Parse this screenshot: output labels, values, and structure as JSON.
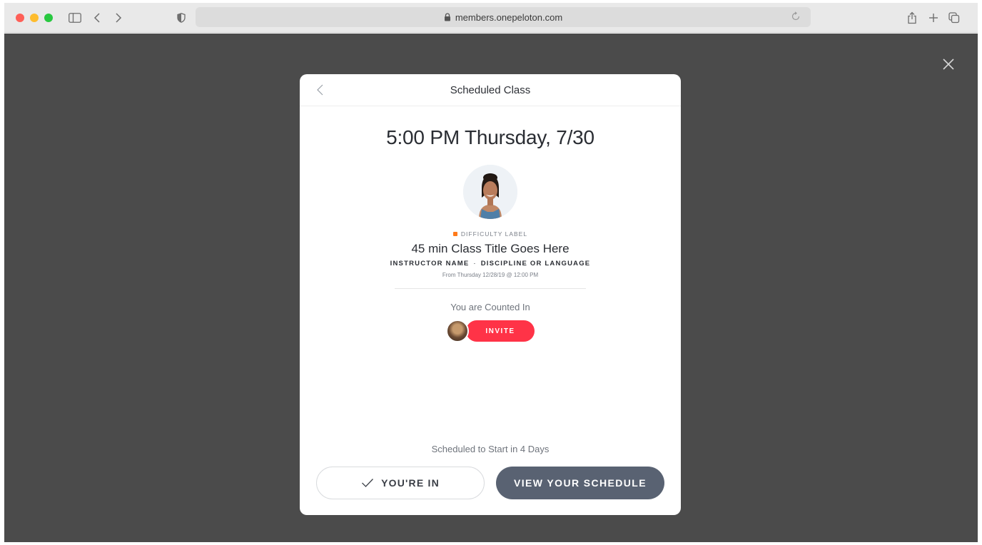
{
  "browser": {
    "url": "members.onepeloton.com",
    "icons": [
      "sidebar-icon",
      "back-icon",
      "forward-icon",
      "shield-icon",
      "lock-icon",
      "reload-icon",
      "share-icon",
      "new-tab-icon",
      "tabs-overview-icon"
    ]
  },
  "overlay": {
    "close_icon": "close-icon"
  },
  "modal": {
    "title": "Scheduled Class",
    "datetime": "5:00 PM Thursday, 7/30",
    "difficulty_label": "DIFFICULTY LABEL",
    "difficulty_color": "#ff7a1a",
    "class_title": "45 min Class Title Goes Here",
    "instructor": "INSTRUCTOR NAME",
    "separator": "·",
    "discipline": "DISCIPLINE OR LANGUAGE",
    "from_text": "From Thursday 12/28/19 @ 12:00 PM",
    "counted_text": "You are Counted In",
    "invite_label": "INVITE",
    "starts_text": "Scheduled to Start in 4 Days",
    "youre_in_label": "YOU'RE IN",
    "view_schedule_label": "VIEW YOUR SCHEDULE"
  },
  "colors": {
    "accent_red": "#ff3347",
    "button_slate": "#596272",
    "overlay": "#4b4b4b"
  }
}
